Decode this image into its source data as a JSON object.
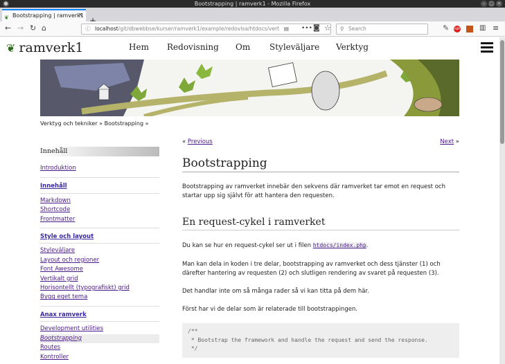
{
  "window": {
    "title": "Bootstrapping | ramverk1 - Mozilla Firefox"
  },
  "tab": {
    "title": "Bootstrapping | ramverk1"
  },
  "url": {
    "host": "localhost",
    "path": "/git/dbwebbse/kurser/ramverk1/example/redovisa/htdocs/vert"
  },
  "search": {
    "placeholder": "Search"
  },
  "site": {
    "name": "ramverk1"
  },
  "menu": [
    "Hem",
    "Redovisning",
    "Om",
    "Styleväljare",
    "Verktyg"
  ],
  "breadcrumb": "Verktyg och tekniker » Bootstrapping »",
  "sidebar": {
    "title": "Innehåll",
    "links0": [
      "Introduktion"
    ],
    "sec1": "Innehåll",
    "links1": [
      "Markdown",
      "Shortcode",
      "Frontmatter"
    ],
    "sec2": "Style och layout",
    "links2": [
      "Styleväljare",
      "Layout och regioner",
      "Font Awesome",
      "Vertikalt grid",
      "Horisontellt (typografiskt) grid",
      "Bygg eget tema"
    ],
    "sec3": "Anax ramverk",
    "links3": [
      "Development utilities",
      "Bootstrapping",
      "Routes",
      "Kontroller"
    ]
  },
  "pager": {
    "prev": "Previous",
    "next": "Next",
    "prev_sym": "«",
    "next_sym": "»"
  },
  "article": {
    "title": "Bootstrapping",
    "intro": "Bootstrapping av ramverket innebär den sekvens där ramverket tar emot en request och startar upp sig självt för att hantera den requesten.",
    "h2": "En request-cykel i ramverket",
    "p1a": "Du kan se hur en request-cykel ser ut i filen",
    "p1code": "htdocs/index.php",
    "p1b": ".",
    "p2": "Man kan dela in koden i tre delar, bootstrapping av ramverket och dess tjänster (1) och därefter hantering av requesten (2) och slutligen rendering av svaret på requesten (3).",
    "p3": "Det handlar inte om så många rader så vi kan titta på dem här.",
    "p4": "Först har vi de delar som är relaterade till bootstrappingen.",
    "code": "/**\n * Bootstrap the framework and handle the request and send the response.\n */"
  },
  "colors": {
    "link": "#4a1a8a",
    "accent": "#0a84ff"
  }
}
